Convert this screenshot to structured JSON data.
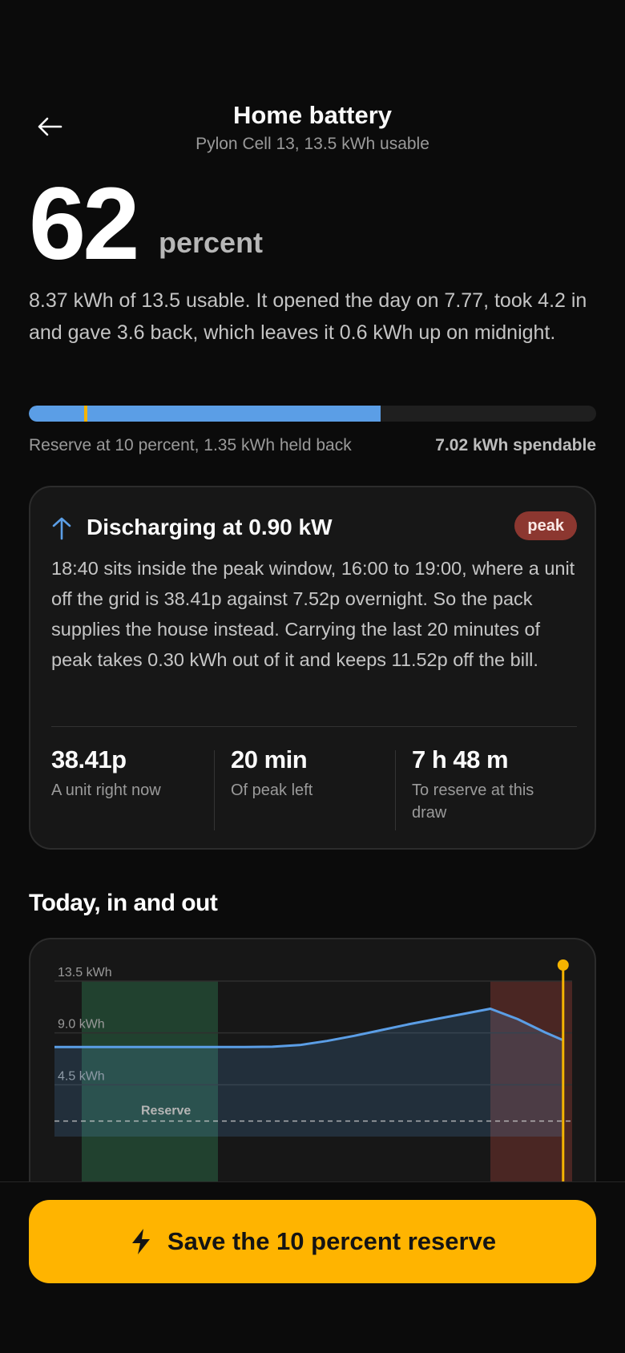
{
  "header": {
    "back_icon": "arrow-left-icon",
    "title": "Home battery",
    "subtitle": "Pylon Cell 13, 13.5 kWh usable"
  },
  "charge": {
    "percent": "62",
    "unit": "percent",
    "summary": "8.37 kWh of 13.5 usable. It opened the day on 7.77, took 4.2 in and gave 3.6 back, which leaves it 0.6 kWh up on midnight.",
    "fill_fraction": 0.62,
    "reserve_fraction": 0.1,
    "reserve_label": "Reserve at 10 percent, 1.35 kWh held back",
    "spendable_label": "7.02 kWh spendable"
  },
  "status_card": {
    "icon": "arrow-up-icon",
    "title": "Discharging at 0.90 kW",
    "badge": "peak",
    "body": "18:40 sits inside the peak window, 16:00 to 19:00, where a unit off the grid is 38.41p against 7.52p overnight. So the pack supplies the house instead. Carrying the last 20 minutes of peak takes 0.30 kWh out of it and keeps 11.52p off the bill.",
    "stats": [
      {
        "value": "38.41p",
        "label": "A unit right now"
      },
      {
        "value": "20 min",
        "label": "Of peak left"
      },
      {
        "value": "7 h 48 m",
        "label": "To reserve at this draw"
      }
    ]
  },
  "chart_section": {
    "title": "Today, in and out"
  },
  "chart_data": {
    "type": "area",
    "ylabel": "",
    "ytick_labels": [
      "13.5 kWh",
      "9.0 kWh",
      "4.5 kWh"
    ],
    "ytick_values": [
      13.5,
      9.0,
      4.5
    ],
    "ylim": [
      0,
      13.5
    ],
    "xlim": [
      0,
      18.67
    ],
    "reserve": {
      "label": "Reserve",
      "value": 1.35
    },
    "cheap_band": [
      1.0,
      6.0
    ],
    "peak_band": [
      16.0,
      19.0
    ],
    "now": 18.67,
    "colors": {
      "line": "#5b9ee6",
      "cheap": "#21412f",
      "peak": "#4a2623",
      "now": "#f5b400"
    },
    "series": [
      {
        "x": [
          0,
          6.0,
          7.0,
          8.0,
          9.0,
          10.0,
          11.0,
          12.0,
          13.0,
          14.0,
          15.0,
          16.0,
          17.0,
          18.0,
          18.67
        ],
        "y": [
          7.77,
          7.77,
          7.77,
          7.8,
          7.95,
          8.3,
          8.75,
          9.25,
          9.75,
          10.2,
          10.65,
          11.1,
          10.2,
          9.05,
          8.37
        ]
      }
    ]
  },
  "footer": {
    "cta_icon": "lightning-bolt-icon",
    "cta_label": "Save the 10 percent reserve"
  }
}
